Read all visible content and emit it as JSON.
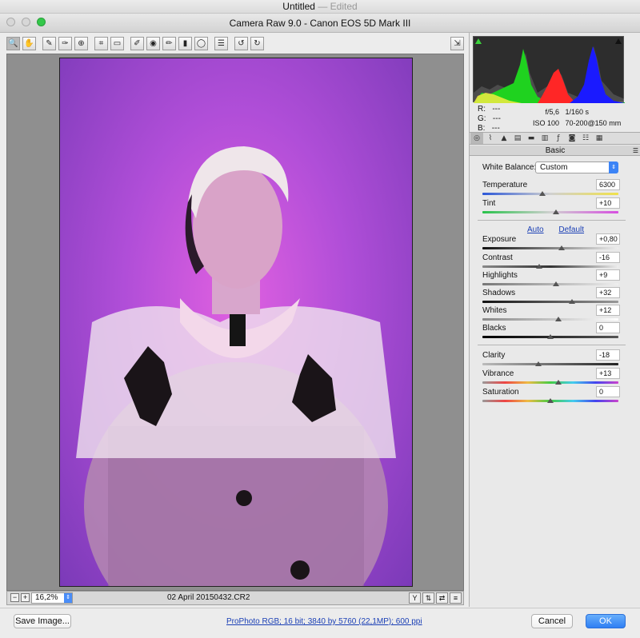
{
  "outer_window": {
    "title": "Untitled",
    "suffix": "— Edited"
  },
  "dialog": {
    "title": "Camera Raw 9.0  -  Canon EOS 5D Mark III"
  },
  "toolbar": {
    "tools": [
      "zoom-icon",
      "hand-icon",
      "eyedropper-icon",
      "color-sampler-icon",
      "targeted-adjust-icon",
      "crop-icon",
      "straighten-icon",
      "spot-removal-icon",
      "red-eye-icon",
      "adjustment-brush-icon",
      "graduated-filter-icon",
      "radial-filter-icon",
      "preferences-icon",
      "rotate-ccw-icon",
      "rotate-cw-icon"
    ],
    "toggle_fullscreen": "fullscreen-icon"
  },
  "status": {
    "zoom": "16,2%",
    "filename": "02 April 20150432.CR2"
  },
  "rgb": {
    "r_label": "R:",
    "r_val": "---",
    "g_label": "G:",
    "g_val": "---",
    "b_label": "B:",
    "b_val": "---"
  },
  "exif": {
    "aperture": "f/5,6",
    "shutter": "1/160 s",
    "iso": "ISO 100",
    "lens": "70-200@150 mm"
  },
  "panel": {
    "title": "Basic"
  },
  "white_balance": {
    "label": "White Balance:",
    "value": "Custom"
  },
  "sliders": {
    "temperature": {
      "label": "Temperature",
      "value": "6300",
      "pos": 0.44
    },
    "tint": {
      "label": "Tint",
      "value": "+10",
      "pos": 0.54
    },
    "exposure": {
      "label": "Exposure",
      "value": "+0,80",
      "pos": 0.58
    },
    "contrast": {
      "label": "Contrast",
      "value": "-16",
      "pos": 0.42
    },
    "highlights": {
      "label": "Highlights",
      "value": "+9",
      "pos": 0.54
    },
    "shadows": {
      "label": "Shadows",
      "value": "+32",
      "pos": 0.66
    },
    "whites": {
      "label": "Whites",
      "value": "+12",
      "pos": 0.56
    },
    "blacks": {
      "label": "Blacks",
      "value": "0",
      "pos": 0.5
    },
    "clarity": {
      "label": "Clarity",
      "value": "-18",
      "pos": 0.41
    },
    "vibrance": {
      "label": "Vibrance",
      "value": "+13",
      "pos": 0.56
    },
    "saturation": {
      "label": "Saturation",
      "value": "0",
      "pos": 0.5
    }
  },
  "links": {
    "auto": "Auto",
    "default": "Default"
  },
  "footer": {
    "save": "Save Image...",
    "workflow": "ProPhoto RGB; 16 bit; 3840 by 5760 (22,1MP); 600 ppi",
    "cancel": "Cancel",
    "ok": "OK"
  }
}
